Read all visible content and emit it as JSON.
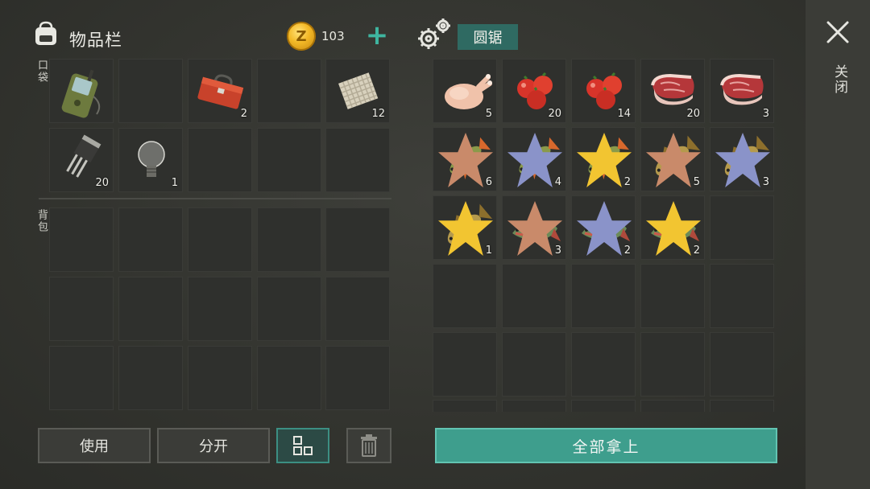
{
  "inventory": {
    "title": "物品栏",
    "coins": "103",
    "pocket_label": "口袋",
    "backpack_label": "背包",
    "pocket_items": [
      {
        "icon": "gps-device-icon",
        "qty": ""
      },
      {
        "icon": "",
        "qty": ""
      },
      {
        "icon": "toolbox-icon",
        "qty": "2"
      },
      {
        "icon": "",
        "qty": ""
      },
      {
        "icon": "cloth-icon",
        "qty": "12"
      },
      {
        "icon": "transistor-icon",
        "qty": "20"
      },
      {
        "icon": "light-bulb-icon",
        "qty": "1"
      },
      {
        "icon": "",
        "qty": ""
      },
      {
        "icon": "",
        "qty": ""
      },
      {
        "icon": "",
        "qty": ""
      }
    ]
  },
  "buttons": {
    "use": "使用",
    "split": "分开",
    "sort_icon": "grid-sort-icon",
    "trash_icon": "trash-icon"
  },
  "container": {
    "title": "圆锯",
    "take_all": "全部拿上",
    "items": [
      {
        "icon": "raw-chicken-icon",
        "qty": "5",
        "star": ""
      },
      {
        "icon": "tomatoes-icon",
        "qty": "20",
        "star": ""
      },
      {
        "icon": "tomatoes-icon",
        "qty": "14",
        "star": ""
      },
      {
        "icon": "raw-steak-icon",
        "qty": "20",
        "star": ""
      },
      {
        "icon": "raw-steak-icon",
        "qty": "3",
        "star": ""
      },
      {
        "icon": "perch-fish-icon",
        "qty": "6",
        "star": "bronze"
      },
      {
        "icon": "perch-fish-icon",
        "qty": "4",
        "star": "silver"
      },
      {
        "icon": "perch-fish-icon",
        "qty": "2",
        "star": "gold"
      },
      {
        "icon": "carp-fish-icon",
        "qty": "5",
        "star": "bronze"
      },
      {
        "icon": "carp-fish-icon",
        "qty": "3",
        "star": "silver"
      },
      {
        "icon": "carp-fish-icon",
        "qty": "1",
        "star": "gold"
      },
      {
        "icon": "pike-fish-icon",
        "qty": "3",
        "star": "bronze"
      },
      {
        "icon": "pike-fish-icon",
        "qty": "2",
        "star": "silver"
      },
      {
        "icon": "pike-fish-icon",
        "qty": "2",
        "star": "gold"
      }
    ]
  },
  "close": {
    "label": "关闭"
  },
  "colors": {
    "accent": "#3e9e8d",
    "star_bronze": "#c98a6a",
    "star_silver": "#8a93c9",
    "star_gold": "#f2c531"
  }
}
